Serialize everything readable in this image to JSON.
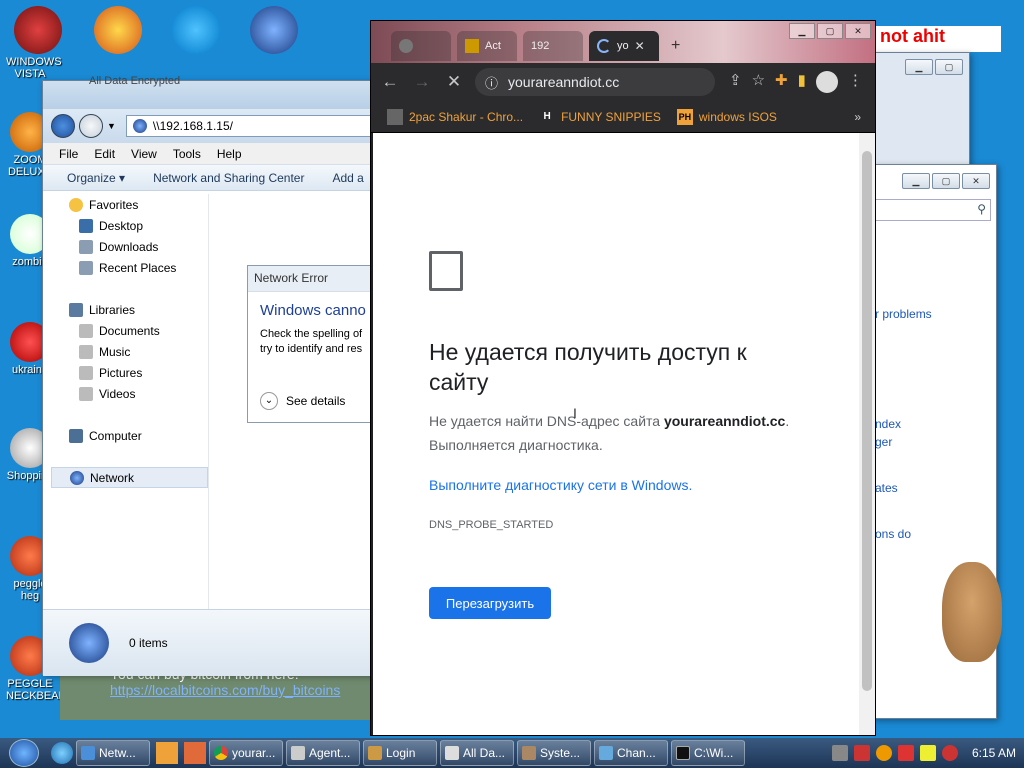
{
  "desktop": {
    "icons": [
      {
        "label": "WINDOWS VISTA"
      },
      {
        "label": "ZOOM DELUXE"
      },
      {
        "label": "zombie"
      },
      {
        "label": "ukraine"
      },
      {
        "label": "Shopping"
      },
      {
        "label": "peggle heg"
      },
      {
        "label": "PEGGLE NECKBEARD"
      }
    ],
    "top_banner": "not ahit"
  },
  "explorer": {
    "title": "All Data Encrypted",
    "address": "\\\\192.168.1.15/",
    "menu": [
      "File",
      "Edit",
      "View",
      "Tools",
      "Help"
    ],
    "commands": {
      "organize": "Organize ▾",
      "network_center": "Network and Sharing Center",
      "add": "Add a"
    },
    "nav": {
      "favorites": "Favorites",
      "desktop": "Desktop",
      "downloads": "Downloads",
      "recent": "Recent Places",
      "libraries": "Libraries",
      "documents": "Documents",
      "music": "Music",
      "pictures": "Pictures",
      "videos": "Videos",
      "computer": "Computer",
      "network": "Network"
    },
    "status": "0 items"
  },
  "network_error": {
    "title": "Network Error",
    "heading": "Windows canno",
    "body_line1": "Check the spelling of",
    "body_line2": "try to identify and res",
    "details": "See details"
  },
  "bg_page": {
    "line1": "You can buy bitcoin from here:",
    "link": "https://localbitcoins.com/buy_bitcoins"
  },
  "right_window": {
    "links": [
      "r problems",
      "ndex",
      "ger",
      "ates",
      "ons do"
    ]
  },
  "chrome": {
    "tabs": [
      "",
      "Act",
      "192",
      "yo"
    ],
    "url": "yourareanndiot.cc",
    "bookmarks": [
      {
        "icon": "2pac",
        "label": "2pac Shakur - Chro..."
      },
      {
        "icon": "H",
        "label": "FUNNY SNIPPIES"
      },
      {
        "icon": "PH",
        "label": "windows ISOS"
      }
    ],
    "error": {
      "title": "Не удается получить доступ к сайту",
      "body_prefix": "Не удается найти DNS-адрес сайта ",
      "body_domain": "yourareanndiot.cc",
      "body_suffix": ".",
      "body_line2": "Выполняется диагностика.",
      "link": "Выполните диагностику сети в Windows.",
      "code": "DNS_PROBE_STARTED",
      "reload": "Перезагрузить"
    }
  },
  "taskbar": {
    "tasks": [
      "Netw...",
      "yourar...",
      "Agent...",
      "Login",
      "All Da...",
      "Syste...",
      "Chan...",
      "C:\\Wi..."
    ],
    "clock": "6:15 AM"
  },
  "colors": {
    "desktop_bg": "#1a8ad4",
    "chrome_dark": "#2b2b2e",
    "bookmark_text": "#f0a23a",
    "link_blue": "#1a73e8"
  }
}
